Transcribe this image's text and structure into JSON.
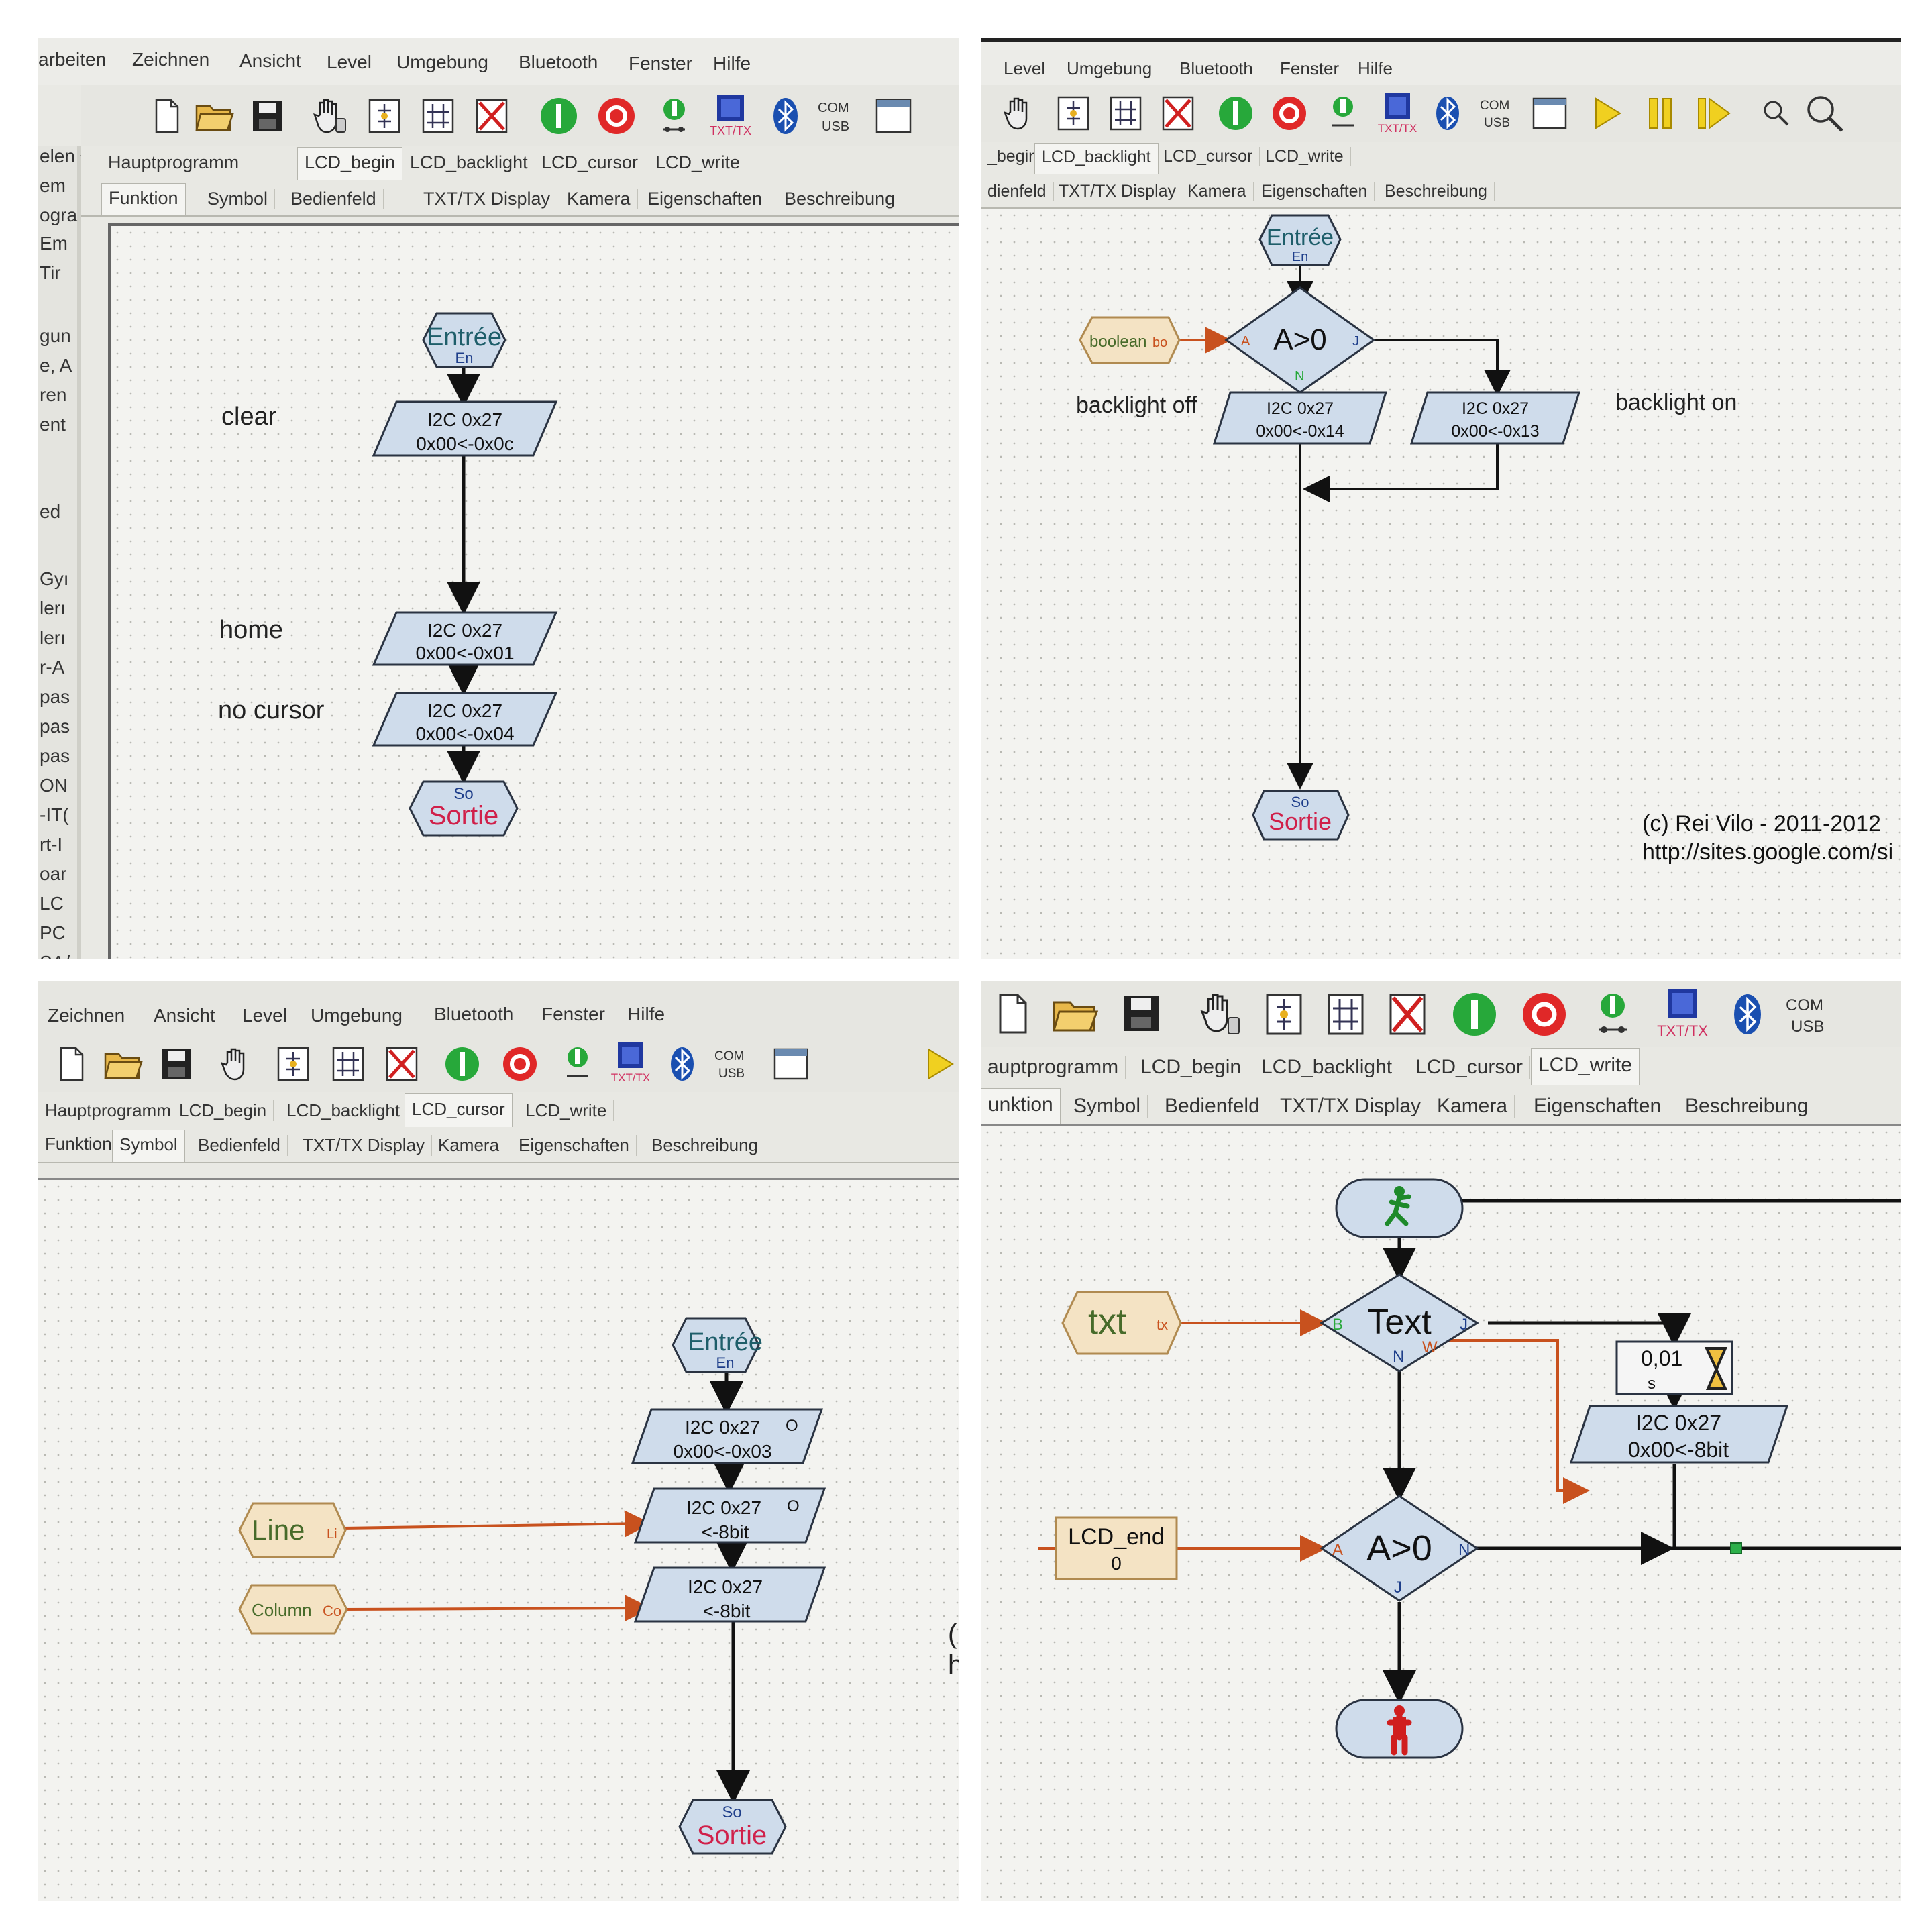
{
  "panel1": {
    "menu": [
      "arbeiten",
      "Zeichnen",
      "Ansicht",
      "Level",
      "Umgebung",
      "Bluetooth",
      "Fenster",
      "Hilfe"
    ],
    "sidebar": [
      "elen ^",
      "em",
      "ogra",
      "Em",
      "Tir",
      "gun",
      "e, A",
      "ren",
      "ent",
      "ed",
      "Gyı",
      "lerı",
      "lerı",
      "r-A",
      "pas",
      "pas",
      "pas",
      "ON",
      "-IT(",
      "rt-I",
      "oar",
      "LC",
      "PC",
      "SA/"
    ],
    "tabs": [
      "Hauptprogramm",
      "LCD_begin",
      "LCD_backlight",
      "LCD_cursor",
      "LCD_write"
    ],
    "subtabs": [
      "Funktion",
      "Symbol",
      "Bedienfeld",
      "TXT/TX Display",
      "Kamera",
      "Eigenschaften",
      "Beschreibung"
    ],
    "entry": {
      "label": "Entrée",
      "sub": "En"
    },
    "exit": {
      "label": "Sortie",
      "sub": "So"
    },
    "steps": [
      {
        "comment": "clear",
        "l1": "I2C 0x27",
        "l2": "0x00<-0x0c"
      },
      {
        "comment": "home",
        "l1": "I2C 0x27",
        "l2": "0x00<-0x01"
      },
      {
        "comment": "no cursor",
        "l1": "I2C 0x27",
        "l2": "0x00<-0x04"
      }
    ]
  },
  "panel2": {
    "menu": [
      "Level",
      "Umgebung",
      "Bluetooth",
      "Fenster",
      "Hilfe"
    ],
    "tabs": [
      "_begin",
      "LCD_backlight",
      "LCD_cursor",
      "LCD_write"
    ],
    "subtabs": [
      "dienfeld",
      "TXT/TX Display",
      "Kamera",
      "Eigenschaften",
      "Beschreibung"
    ],
    "entry": {
      "label": "Entrée",
      "sub": "En"
    },
    "exit": {
      "label": "Sortie",
      "sub": "So"
    },
    "input": {
      "label": "boolean",
      "port": "bo"
    },
    "decision": {
      "label": "A>0",
      "a": "A",
      "j": "J",
      "n": "N"
    },
    "left": {
      "comment": "backlight off",
      "l1": "I2C 0x27",
      "l2": "0x00<-0x14"
    },
    "right": {
      "comment": "backlight on",
      "l1": "I2C 0x27",
      "l2": "0x00<-0x13"
    },
    "copyright": "(c) Rei Vilo - 2011-2012",
    "url": "http://sites.google.com/si"
  },
  "panel3": {
    "menu": [
      "Zeichnen",
      "Ansicht",
      "Level",
      "Umgebung",
      "Bluetooth",
      "Fenster",
      "Hilfe"
    ],
    "tabs": [
      "Hauptprogramm",
      "LCD_begin",
      "LCD_backlight",
      "LCD_cursor",
      "LCD_write"
    ],
    "subtabs": [
      "Funktion",
      "Symbol",
      "Bedienfeld",
      "TXT/TX Display",
      "Kamera",
      "Eigenschaften",
      "Beschreibung"
    ],
    "entry": {
      "label": "Entrée",
      "sub": "En"
    },
    "exit": {
      "label": "Sortie",
      "sub": "So"
    },
    "steps": [
      {
        "l1": "I2C 0x27",
        "l2": "0x00<-0x03",
        "o": "O"
      },
      {
        "l1": "I2C 0x27",
        "l2": "<-8bit",
        "o": "O"
      },
      {
        "l1": "I2C 0x27",
        "l2": "<-8bit",
        "o": ""
      }
    ],
    "inputs": [
      {
        "label": "Line",
        "port": "Li"
      },
      {
        "label": "Column",
        "port": "Co"
      }
    ],
    "edge": "(",
    "edge2": "h"
  },
  "panel4": {
    "tabs": [
      "auptprogramm",
      "LCD_begin",
      "LCD_backlight",
      "LCD_cursor",
      "LCD_write"
    ],
    "subtabs": [
      "unktion",
      "Symbol",
      "Bedienfeld",
      "TXT/TX Display",
      "Kamera",
      "Eigenschaften",
      "Beschreibung"
    ],
    "input_txt": {
      "label": "txt",
      "port": "tx"
    },
    "decision1": {
      "label": "Text",
      "b": "B",
      "j": "J",
      "n": "N",
      "w": "W"
    },
    "wait": {
      "value": "0,01",
      "unit": "s"
    },
    "i2c": {
      "l1": "I2C 0x27",
      "l2": "0x00<-8bit"
    },
    "lcd_end": {
      "label": "LCD_end",
      "value": "0"
    },
    "decision2": {
      "label": "A>0",
      "a": "A",
      "j": "J",
      "n": "N"
    }
  },
  "toolbar_text": {
    "com": "COM",
    "usb": "USB",
    "txt": "TXT/TX"
  },
  "colors": {
    "shape_fill": "#cfdceb",
    "shape_stroke": "#2a3342",
    "orange_wire": "#c8511e",
    "entry_text": "#1e5e6a",
    "exit_text": "#d0204a",
    "input_fill": "#f4e3c4",
    "input_text": "#476b2a"
  }
}
